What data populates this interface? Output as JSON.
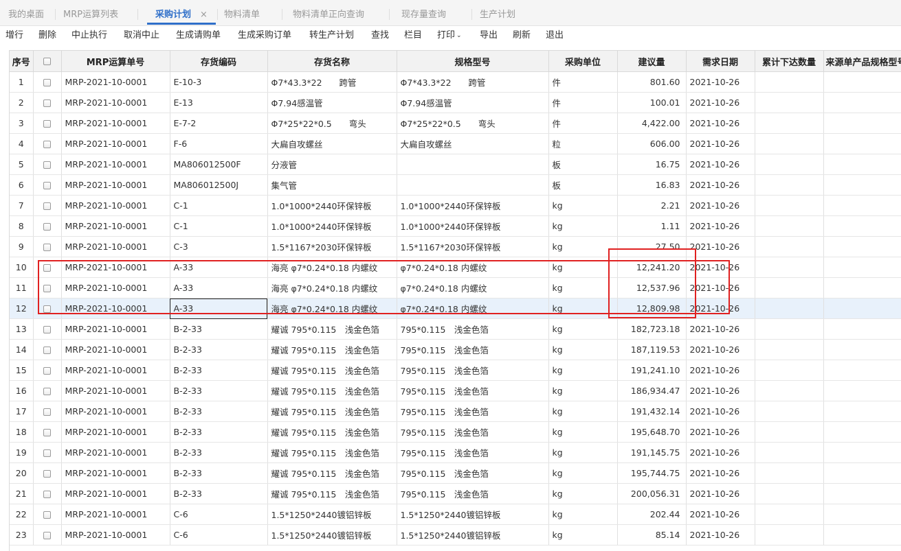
{
  "tabs": [
    {
      "label": "我的桌面",
      "active": false
    },
    {
      "label": "MRP运算列表",
      "active": false
    },
    {
      "label": "采购计划",
      "active": true
    },
    {
      "label": "物料清单",
      "active": false
    },
    {
      "label": "物料清单正向查询",
      "active": false
    },
    {
      "label": "现存量查询",
      "active": false
    },
    {
      "label": "生产计划",
      "active": false
    }
  ],
  "tab_close_glyph": "×",
  "toolbar": {
    "add": "增行",
    "delete": "删除",
    "suspend": "中止执行",
    "cancel_suspend": "取消中止",
    "gen_requisition": "生成请购单",
    "gen_purchase_order": "生成采购订单",
    "to_production_plan": "转生产计划",
    "find": "查找",
    "columns": "栏目",
    "print": "打印",
    "print_chevron": "⌄",
    "export": "导出",
    "refresh": "刷新",
    "exit": "退出"
  },
  "columns": {
    "seq": "序号",
    "mrp_no": "MRP运算单号",
    "inv_code": "存货编码",
    "inv_name": "存货名称",
    "spec": "规格型号",
    "unit": "采购单位",
    "suggest_qty": "建议量",
    "demand_date": "需求日期",
    "accum_qty": "累计下达数量",
    "source_spec": "来源单产品规格型号"
  },
  "rows": [
    {
      "seq": "1",
      "mrp_no": "MRP-2021-10-0001",
      "inv_code": "E-10-3",
      "inv_name": "Φ7*43.3*22　　跨管",
      "spec": "Φ7*43.3*22　　跨管",
      "unit": "件",
      "qty": "801.60",
      "date": "2021-10-26"
    },
    {
      "seq": "2",
      "mrp_no": "MRP-2021-10-0001",
      "inv_code": "E-13",
      "inv_name": "Φ7.94感温管",
      "spec": "Φ7.94感温管",
      "unit": "件",
      "qty": "100.01",
      "date": "2021-10-26"
    },
    {
      "seq": "3",
      "mrp_no": "MRP-2021-10-0001",
      "inv_code": "E-7-2",
      "inv_name": "Φ7*25*22*0.5　　弯头",
      "spec": "Φ7*25*22*0.5　　弯头",
      "unit": "件",
      "qty": "4,422.00",
      "date": "2021-10-26"
    },
    {
      "seq": "4",
      "mrp_no": "MRP-2021-10-0001",
      "inv_code": "F-6",
      "inv_name": "大扁自攻螺丝",
      "spec": "大扁自攻螺丝",
      "unit": "粒",
      "qty": "606.00",
      "date": "2021-10-26"
    },
    {
      "seq": "5",
      "mrp_no": "MRP-2021-10-0001",
      "inv_code": "MA806012500F",
      "inv_name": "分液管",
      "spec": "",
      "unit": "板",
      "qty": "16.75",
      "date": "2021-10-26"
    },
    {
      "seq": "6",
      "mrp_no": "MRP-2021-10-0001",
      "inv_code": "MA806012500J",
      "inv_name": "集气管",
      "spec": "",
      "unit": "板",
      "qty": "16.83",
      "date": "2021-10-26"
    },
    {
      "seq": "7",
      "mrp_no": "MRP-2021-10-0001",
      "inv_code": "C-1",
      "inv_name": "1.0*1000*2440环保锌板",
      "spec": "1.0*1000*2440环保锌板",
      "unit": "kg",
      "qty": "2.21",
      "date": "2021-10-26"
    },
    {
      "seq": "8",
      "mrp_no": "MRP-2021-10-0001",
      "inv_code": "C-1",
      "inv_name": "1.0*1000*2440环保锌板",
      "spec": "1.0*1000*2440环保锌板",
      "unit": "kg",
      "qty": "1.11",
      "date": "2021-10-26"
    },
    {
      "seq": "9",
      "mrp_no": "MRP-2021-10-0001",
      "inv_code": "C-3",
      "inv_name": "1.5*1167*2030环保锌板",
      "spec": "1.5*1167*2030环保锌板",
      "unit": "kg",
      "qty": "27.50",
      "date": "2021-10-26"
    },
    {
      "seq": "10",
      "mrp_no": "MRP-2021-10-0001",
      "inv_code": "A-33",
      "inv_name": "海亮 φ7*0.24*0.18  内螺纹",
      "spec": "φ7*0.24*0.18  内螺纹",
      "unit": "kg",
      "qty": "12,241.20",
      "date": "2021-10-26"
    },
    {
      "seq": "11",
      "mrp_no": "MRP-2021-10-0001",
      "inv_code": "A-33",
      "inv_name": "海亮 φ7*0.24*0.18  内螺纹",
      "spec": "φ7*0.24*0.18  内螺纹",
      "unit": "kg",
      "qty": "12,537.96",
      "date": "2021-10-26"
    },
    {
      "seq": "12",
      "mrp_no": "MRP-2021-10-0001",
      "inv_code": "A-33",
      "inv_name": "海亮 φ7*0.24*0.18  内螺纹",
      "spec": "φ7*0.24*0.18  内螺纹",
      "unit": "kg",
      "qty": "12,809.98",
      "date": "2021-10-26"
    },
    {
      "seq": "13",
      "mrp_no": "MRP-2021-10-0001",
      "inv_code": "B-2-33",
      "inv_name": "耀诚 795*0.115　浅金色箔",
      "spec": "795*0.115　浅金色箔",
      "unit": "kg",
      "qty": "182,723.18",
      "date": "2021-10-26"
    },
    {
      "seq": "14",
      "mrp_no": "MRP-2021-10-0001",
      "inv_code": "B-2-33",
      "inv_name": "耀诚 795*0.115　浅金色箔",
      "spec": "795*0.115　浅金色箔",
      "unit": "kg",
      "qty": "187,119.53",
      "date": "2021-10-26"
    },
    {
      "seq": "15",
      "mrp_no": "MRP-2021-10-0001",
      "inv_code": "B-2-33",
      "inv_name": "耀诚 795*0.115　浅金色箔",
      "spec": "795*0.115　浅金色箔",
      "unit": "kg",
      "qty": "191,241.10",
      "date": "2021-10-26"
    },
    {
      "seq": "16",
      "mrp_no": "MRP-2021-10-0001",
      "inv_code": "B-2-33",
      "inv_name": "耀诚 795*0.115　浅金色箔",
      "spec": "795*0.115　浅金色箔",
      "unit": "kg",
      "qty": "186,934.47",
      "date": "2021-10-26"
    },
    {
      "seq": "17",
      "mrp_no": "MRP-2021-10-0001",
      "inv_code": "B-2-33",
      "inv_name": "耀诚 795*0.115　浅金色箔",
      "spec": "795*0.115　浅金色箔",
      "unit": "kg",
      "qty": "191,432.14",
      "date": "2021-10-26"
    },
    {
      "seq": "18",
      "mrp_no": "MRP-2021-10-0001",
      "inv_code": "B-2-33",
      "inv_name": "耀诚 795*0.115　浅金色箔",
      "spec": "795*0.115　浅金色箔",
      "unit": "kg",
      "qty": "195,648.70",
      "date": "2021-10-26"
    },
    {
      "seq": "19",
      "mrp_no": "MRP-2021-10-0001",
      "inv_code": "B-2-33",
      "inv_name": "耀诚 795*0.115　浅金色箔",
      "spec": "795*0.115　浅金色箔",
      "unit": "kg",
      "qty": "191,145.75",
      "date": "2021-10-26"
    },
    {
      "seq": "20",
      "mrp_no": "MRP-2021-10-0001",
      "inv_code": "B-2-33",
      "inv_name": "耀诚 795*0.115　浅金色箔",
      "spec": "795*0.115　浅金色箔",
      "unit": "kg",
      "qty": "195,744.75",
      "date": "2021-10-26"
    },
    {
      "seq": "21",
      "mrp_no": "MRP-2021-10-0001",
      "inv_code": "B-2-33",
      "inv_name": "耀诚 795*0.115　浅金色箔",
      "spec": "795*0.115　浅金色箔",
      "unit": "kg",
      "qty": "200,056.31",
      "date": "2021-10-26"
    },
    {
      "seq": "22",
      "mrp_no": "MRP-2021-10-0001",
      "inv_code": "C-6",
      "inv_name": "1.5*1250*2440镀铝锌板",
      "spec": "1.5*1250*2440镀铝锌板",
      "unit": "kg",
      "qty": "202.44",
      "date": "2021-10-26"
    },
    {
      "seq": "23",
      "mrp_no": "MRP-2021-10-0001",
      "inv_code": "C-6",
      "inv_name": "1.5*1250*2440镀铝锌板",
      "spec": "1.5*1250*2440镀铝锌板",
      "unit": "kg",
      "qty": "85.14",
      "date": "2021-10-26"
    }
  ],
  "selected_row": "12",
  "colors": {
    "accent": "#2f6fc9",
    "annotation": "#e02020",
    "selected_row_bg": "#e8f1fb"
  }
}
